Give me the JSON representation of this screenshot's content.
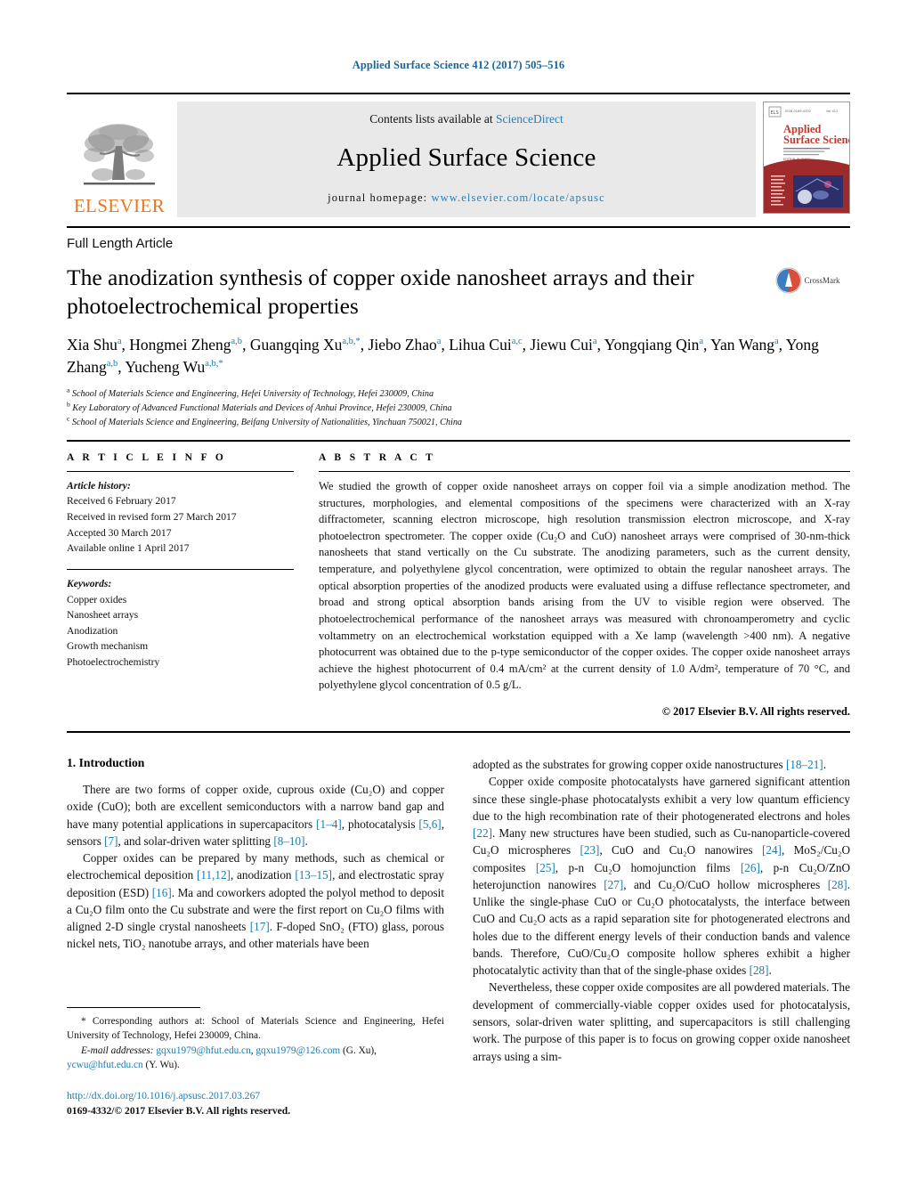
{
  "running_head": "Applied Surface Science 412 (2017) 505–516",
  "masthead": {
    "contents_prefix": "Contents lists available at ",
    "sciencedirect": "ScienceDirect",
    "journal_title": "Applied Surface Science",
    "homepage_prefix": "journal homepage: ",
    "homepage_url": "www.elsevier.com/locate/apsusc",
    "publisher": "ELSEVIER",
    "cover_title_line1": "Applied",
    "cover_title_line2": "Surface Science",
    "accent_blue": "#2a7db5",
    "elsevier_orange": "#e87722",
    "band_gray": "#e9e9e9"
  },
  "article": {
    "type": "Full Length Article",
    "title": "The anodization synthesis of copper oxide nanosheet arrays and their photoelectrochemical properties",
    "crossmark_label": "CrossMark"
  },
  "authors": {
    "line1_parts": [
      {
        "name": "Xia Shu",
        "sup": "a"
      },
      {
        "name": "Hongmei Zheng",
        "sup": "a,b"
      },
      {
        "name": "Guangqing Xu",
        "sup": "a,b,*"
      },
      {
        "name": "Jiebo Zhao",
        "sup": "a"
      },
      {
        "name": "Lihua Cui",
        "sup": "a,c"
      },
      {
        "name": "Jiewu Cui",
        "sup": "a"
      },
      {
        "name": "Yongqiang Qin",
        "sup": "a"
      },
      {
        "name": "Yan Wang",
        "sup": "a"
      },
      {
        "name": "Yong Zhang",
        "sup": "a,b"
      },
      {
        "name": "Yucheng Wu",
        "sup": "a,b,*"
      }
    ],
    "affiliations": [
      {
        "marker": "a",
        "text": "School of Materials Science and Engineering, Hefei University of Technology, Hefei 230009, China"
      },
      {
        "marker": "b",
        "text": "Key Laboratory of Advanced Functional Materials and Devices of Anhui Province, Hefei 230009, China"
      },
      {
        "marker": "c",
        "text": "School of Materials Science and Engineering, Beifang University of Nationalities, Yinchuan 750021, China"
      }
    ]
  },
  "article_info": {
    "heading": "A R T I C L E   I N F O",
    "history_label": "Article history:",
    "history": [
      "Received 6 February 2017",
      "Received in revised form 27 March 2017",
      "Accepted 30 March 2017",
      "Available online 1 April 2017"
    ],
    "keywords_label": "Keywords:",
    "keywords": [
      "Copper oxides",
      "Nanosheet arrays",
      "Anodization",
      "Growth mechanism",
      "Photoelectrochemistry"
    ]
  },
  "abstract": {
    "heading": "A B S T R A C T",
    "text": "We studied the growth of copper oxide nanosheet arrays on copper foil via a simple anodization method. The structures, morphologies, and elemental compositions of the specimens were characterized with an X-ray diffractometer, scanning electron microscope, high resolution transmission electron microscope, and X-ray photoelectron spectrometer. The copper oxide (Cu₂O and CuO) nanosheet arrays were comprised of 30-nm-thick nanosheets that stand vertically on the Cu substrate. The anodizing parameters, such as the current density, temperature, and polyethylene glycol concentration, were optimized to obtain the regular nanosheet arrays. The optical absorption properties of the anodized products were evaluated using a diffuse reflectance spectrometer, and broad and strong optical absorption bands arising from the UV to visible region were observed. The photoelectrochemical performance of the nanosheet arrays was measured with chronoamperometry and cyclic voltammetry on an electrochemical workstation equipped with a Xe lamp (wavelength >400 nm). A negative photocurrent was obtained due to the p-type semiconductor of the copper oxides. The copper oxide nanosheet arrays achieve the highest photocurrent of 0.4 mA/cm² at the current density of 1.0 A/dm², temperature of 70 °C, and polyethylene glycol concentration of 0.5 g/L.",
    "copyright": "© 2017 Elsevier B.V. All rights reserved."
  },
  "body": {
    "section_number_title": "1.  Introduction",
    "left_paragraphs": [
      "There are two forms of copper oxide, cuprous oxide (Cu₂O) and copper oxide (CuO); both are excellent semiconductors with a narrow band gap and have many potential applications in supercapacitors [1–4], photocatalysis [5,6], sensors [7], and solar-driven water splitting [8–10].",
      "Copper oxides can be prepared by many methods, such as chemical or electrochemical deposition [11,12], anodization [13–15], and electrostatic spray deposition (ESD) [16]. Ma and coworkers adopted the polyol method to deposit a Cu₂O film onto the Cu substrate and were the first report on Cu₂O films with aligned 2-D single crystal nanosheets [17]. F-doped SnO₂ (FTO) glass, porous nickel nets, TiO₂ nanotube arrays, and other materials have been"
    ],
    "right_paragraphs": [
      "adopted as the substrates for growing copper oxide nanostructures [18–21].",
      "Copper oxide composite photocatalysts have garnered significant attention since these single-phase photocatalysts exhibit a very low quantum efficiency due to the high recombination rate of their photogenerated electrons and holes [22]. Many new structures have been studied, such as Cu-nanoparticle-covered Cu₂O microspheres [23], CuO and Cu₂O nanowires [24], MoS₂/Cu₂O composites [25], p-n Cu₂O homojunction films [26], p-n Cu₂O/ZnO heterojunction nanowires [27], and Cu₂O/CuO hollow microspheres [28]. Unlike the single-phase CuO or Cu₂O photocatalysts, the interface between CuO and Cu₂O acts as a rapid separation site for photogenerated electrons and holes due to the different energy levels of their conduction bands and valence bands. Therefore, CuO/Cu₂O composite hollow spheres exhibit a higher photocatalytic activity than that of the single-phase oxides [28].",
      "Nevertheless, these copper oxide composites are all powdered materials. The development of commercially-viable copper oxides used for photocatalysis, sensors, solar-driven water splitting, and supercapacitors is still challenging work. The purpose of this paper is to focus on growing copper oxide nanosheet arrays using a sim-"
    ]
  },
  "footnote": {
    "corresponding": "* Corresponding authors at: School of Materials Science and Engineering, Hefei University of Technology, Hefei 230009, China.",
    "email_label": "E-mail addresses:",
    "email1": "gqxu1979@hfut.edu.cn",
    "email2": "gqxu1979@126.com",
    "email1_attrib": "(G. Xu),",
    "email3": "ycwu@hfut.edu.cn",
    "email3_attrib": "(Y. Wu).",
    "doi": "http://dx.doi.org/10.1016/j.apsusc.2017.03.267",
    "issn_line": "0169-4332/© 2017 Elsevier B.V. All rights reserved."
  }
}
